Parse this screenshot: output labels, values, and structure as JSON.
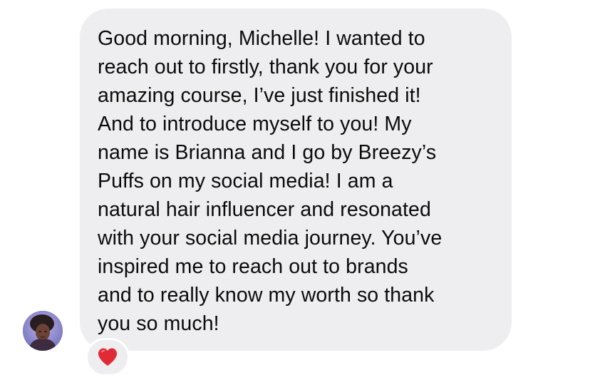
{
  "message": {
    "text": "Good morning, Michelle! I wanted to\nreach out to firstly, thank you for your\namazing course, I’ve just finished it!\nAnd to introduce myself to you! My\nname is Brianna and I go by Breezy’s\nPuffs on my social media! I am a\nnatural hair influencer and resonated\nwith your social media journey. You’ve\ninspired me to reach out to brands\nand to really know my worth so thank\nyou so much!"
  },
  "reaction": {
    "icon": "heart-icon",
    "color": "#e02a36"
  },
  "colors": {
    "bubble": "#eeeef0",
    "text": "#0b0b0b",
    "background": "#ffffff"
  }
}
